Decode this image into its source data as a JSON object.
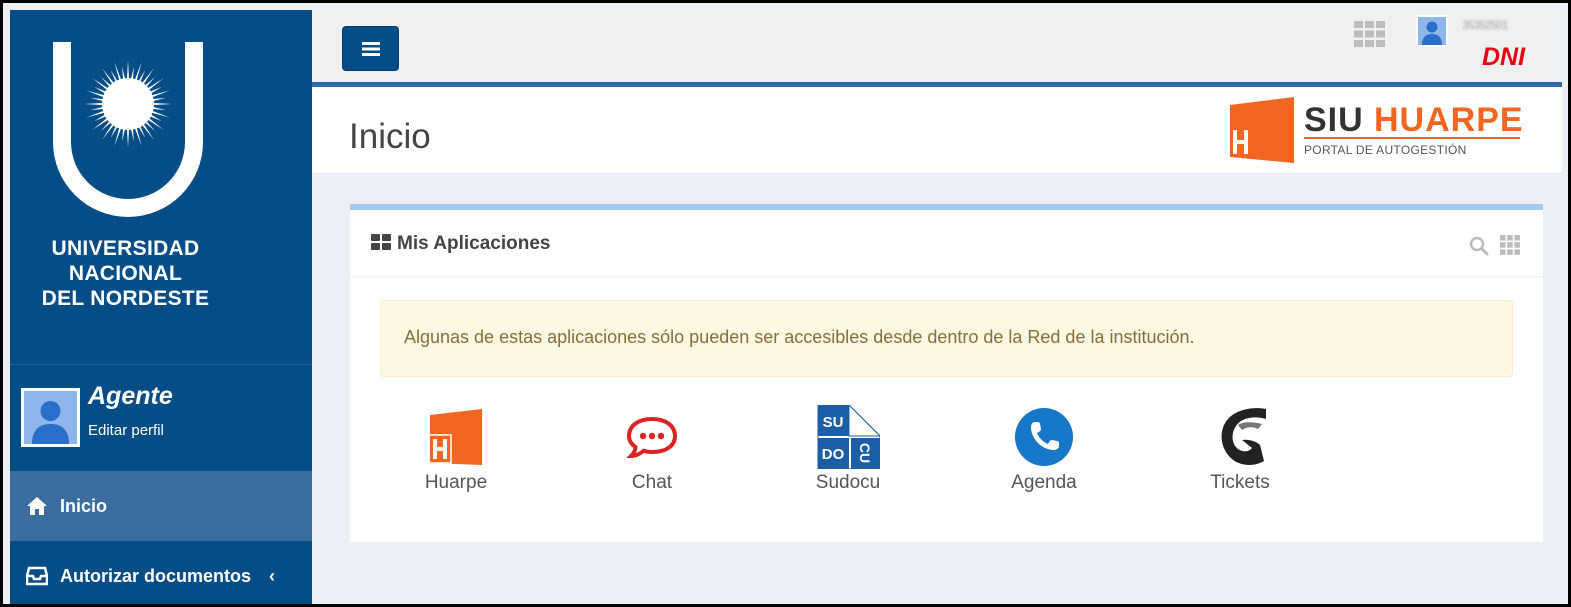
{
  "sidebar": {
    "university_lines": [
      "UNIVERSIDAD",
      "NACIONAL",
      "DEL NORDESTE"
    ],
    "user": {
      "role": "Agente",
      "edit_profile": "Editar perfil"
    },
    "menu": [
      {
        "label": "Inicio",
        "icon": "home-icon",
        "active": true
      },
      {
        "label": "Autorizar documentos",
        "icon": "inbox-icon",
        "has_submenu": true
      }
    ]
  },
  "topbar": {
    "username_redacted": "35352501",
    "dni_label": "DNI",
    "icons": [
      "menu-toggle-icon",
      "apps-grid-icon",
      "user-avatar"
    ]
  },
  "header": {
    "title": "Inicio",
    "brand": {
      "part1": "SIU",
      "part2": "HUARPE",
      "subtitle": "PORTAL DE AUTOGESTIÓN"
    }
  },
  "panel": {
    "title": "Mis Aplicaciones",
    "alert": "Algunas de estas aplicaciones sólo pueden ser accesibles desde dentro de la Red de la institución.",
    "apps": [
      {
        "label": "Huarpe",
        "icon": "huarpe-icon"
      },
      {
        "label": "Chat",
        "icon": "chat-icon"
      },
      {
        "label": "Sudocu",
        "icon": "sudocu-icon"
      },
      {
        "label": "Agenda",
        "icon": "phone-icon"
      },
      {
        "label": "Tickets",
        "icon": "tickets-icon"
      }
    ],
    "sudocu_icon_letters": [
      "SU",
      "DO",
      "CU"
    ]
  },
  "colors": {
    "sidebar": "#044d86",
    "accent_orange": "#f26622",
    "dni_red": "#e30613",
    "panel_top": "#a6c9ee",
    "alert_bg": "#fcf8e3"
  }
}
